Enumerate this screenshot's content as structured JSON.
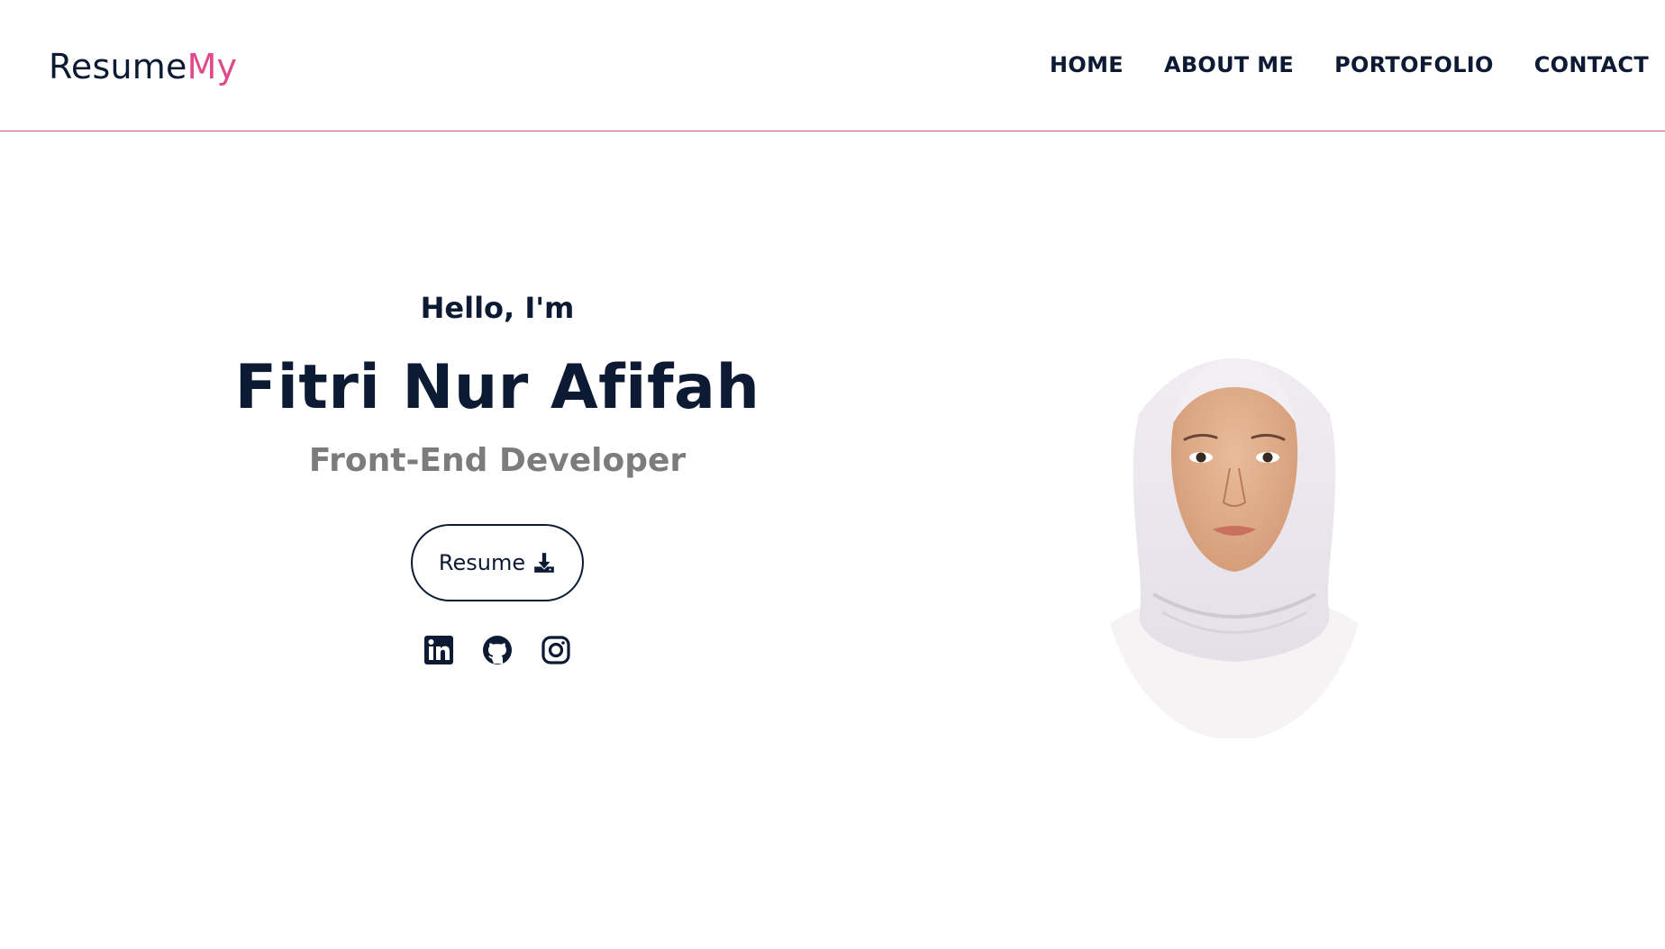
{
  "brand": {
    "part1": "Resume",
    "part2": "My",
    "colors": {
      "primary": "#0c1b33",
      "accent": "#e04a8a"
    }
  },
  "nav": {
    "items": [
      {
        "label": "HOME"
      },
      {
        "label": "ABOUT ME"
      },
      {
        "label": "PORTOFOLIO"
      },
      {
        "label": "CONTACT"
      }
    ]
  },
  "hero": {
    "greeting": "Hello, I'm",
    "name": "Fitri Nur Afifah",
    "role": "Front-End Developer",
    "resume_button": {
      "label": "Resume",
      "icon": "download-icon"
    },
    "socials": [
      {
        "icon": "linkedin-icon"
      },
      {
        "icon": "github-icon"
      },
      {
        "icon": "instagram-icon"
      }
    ],
    "portrait": {
      "description": "profile-photo"
    }
  }
}
